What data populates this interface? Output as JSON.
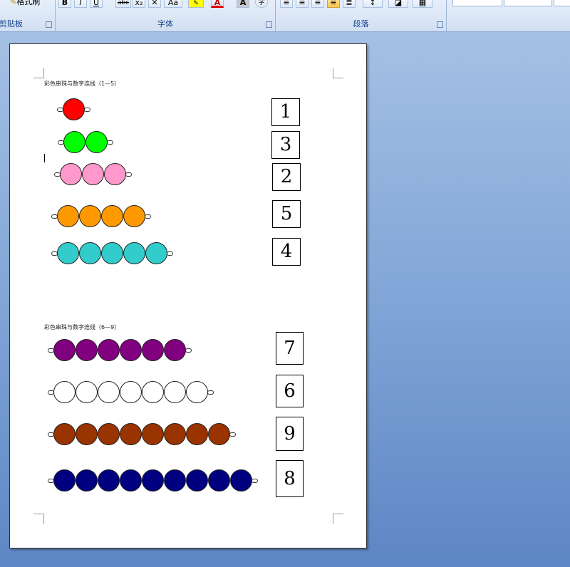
{
  "ribbon": {
    "clipboard": {
      "format_painter_label": "格式刷",
      "group_label": "剪贴板"
    },
    "font": {
      "bold": "B",
      "italic": "I",
      "underline": "U",
      "strike": "abc",
      "subscript": "x₂",
      "clear": "✕",
      "change_case": "Aa",
      "font_color_letter": "A",
      "char_shading": "A",
      "enclose": "字",
      "group_label": "字体"
    },
    "paragraph": {
      "group_label": "段落"
    }
  },
  "document": {
    "section1": {
      "heading": "彩色串珠与数字连线（1—5）",
      "rows": [
        {
          "beads": 1,
          "color": "#ff0000"
        },
        {
          "beads": 2,
          "color": "#00ff00"
        },
        {
          "beads": 3,
          "color": "#ff99cc"
        },
        {
          "beads": 4,
          "color": "#ff9900"
        },
        {
          "beads": 5,
          "color": "#33cccc"
        }
      ],
      "numbers": [
        "1",
        "3",
        "2",
        "5",
        "4"
      ]
    },
    "section2": {
      "heading": "彩色串珠与数字连线（6—9）",
      "rows": [
        {
          "beads": 6,
          "color": "#800080"
        },
        {
          "beads": 7,
          "color": "#ffffff"
        },
        {
          "beads": 8,
          "color": "#993300"
        },
        {
          "beads": 9,
          "color": "#000080"
        }
      ],
      "numbers": [
        "7",
        "6",
        "9",
        "8"
      ]
    }
  }
}
